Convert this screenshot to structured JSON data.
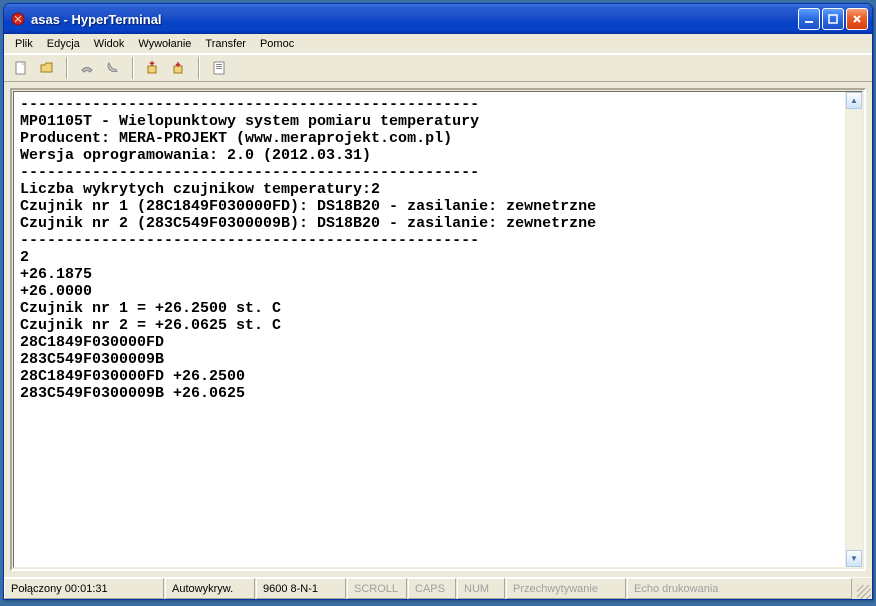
{
  "window": {
    "title": "asas - HyperTerminal"
  },
  "menu": {
    "items": [
      "Plik",
      "Edycja",
      "Widok",
      "Wywołanie",
      "Transfer",
      "Pomoc"
    ]
  },
  "toolbar": {
    "icons": [
      "new-file-icon",
      "open-file-icon",
      "hangup-icon",
      "call-icon",
      "send-icon",
      "receive-icon",
      "properties-icon"
    ]
  },
  "terminal": {
    "lines": [
      "---------------------------------------------------",
      "MP01105T - Wielopunktowy system pomiaru temperatury",
      "Producent: MERA-PROJEKT (www.meraprojekt.com.pl)",
      "Wersja oprogramowania: 2.0 (2012.03.31)",
      "---------------------------------------------------",
      "Liczba wykrytych czujnikow temperatury:2",
      "Czujnik nr 1 (28C1849F030000FD): DS18B20 - zasilanie: zewnetrzne",
      "Czujnik nr 2 (283C549F0300009B): DS18B20 - zasilanie: zewnetrzne",
      "---------------------------------------------------",
      "2",
      "+26.1875",
      "+26.0000",
      "Czujnik nr 1 = +26.2500 st. C",
      "Czujnik nr 2 = +26.0625 st. C",
      "28C1849F030000FD",
      "283C549F0300009B",
      "28C1849F030000FD +26.2500",
      "283C549F0300009B +26.0625"
    ]
  },
  "status": {
    "connection": "Połączony 00:01:31",
    "detect": "Autowykryw.",
    "settings": "9600 8-N-1",
    "scroll": "SCROLL",
    "caps": "CAPS",
    "num": "NUM",
    "capture": "Przechwytywanie",
    "echo": "Echo drukowania"
  }
}
